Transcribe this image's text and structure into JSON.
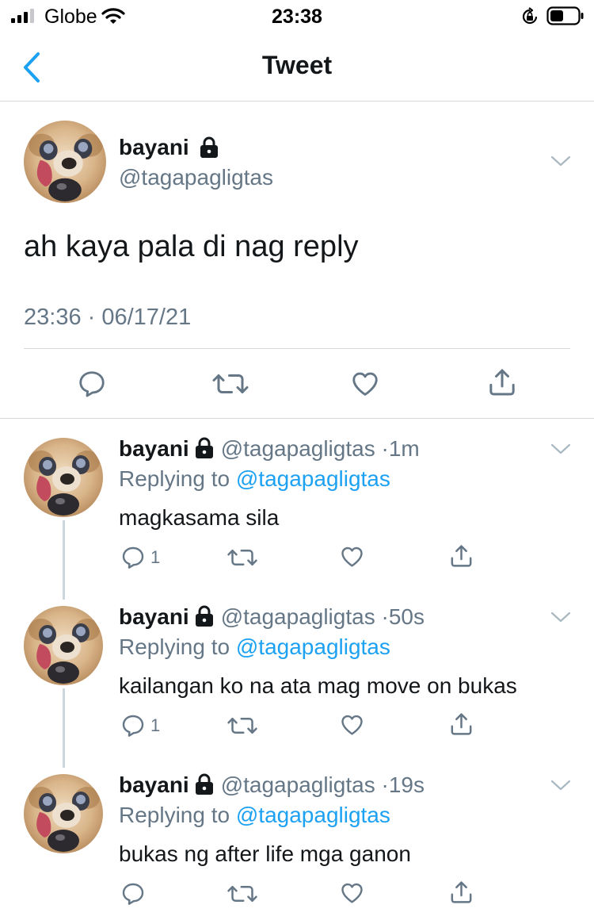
{
  "status_bar": {
    "carrier": "Globe",
    "time": "23:38"
  },
  "nav": {
    "title": "Tweet"
  },
  "main_tweet": {
    "name": "bayani",
    "handle": "@tagapagligtas",
    "text": "ah kaya pala di nag reply",
    "timestamp": "23:36 · 06/17/21"
  },
  "replies": [
    {
      "name": "bayani",
      "handle": "@tagapagligtas",
      "separator": "·",
      "time": "1m",
      "replying_prefix": "Replying to ",
      "replying_to": "@tagapagligtas",
      "text": "magkasama sila",
      "reply_count": "1"
    },
    {
      "name": "bayani",
      "handle": "@tagapagligtas",
      "separator": "·",
      "time": "50s",
      "replying_prefix": "Replying to ",
      "replying_to": "@tagapagligtas",
      "text": "kailangan ko na ata mag move on bukas",
      "reply_count": "1"
    },
    {
      "name": "bayani",
      "handle": "@tagapagligtas",
      "separator": "·",
      "time": "19s",
      "replying_prefix": "Replying to ",
      "replying_to": "@tagapagligtas",
      "text": "bukas ng after life mga ganon",
      "reply_count": ""
    }
  ],
  "colors": {
    "text": "#14171a",
    "secondary": "#657786",
    "link": "#1da1f2",
    "divider": "#d6d9db",
    "thread_line": "#ccd6dd"
  },
  "icons": [
    "signal-icon",
    "wifi-icon",
    "orientation-lock-icon",
    "battery-icon",
    "back-chevron-icon",
    "padlock-icon",
    "chevron-down-icon",
    "reply-icon",
    "retweet-icon",
    "like-icon",
    "share-icon"
  ]
}
